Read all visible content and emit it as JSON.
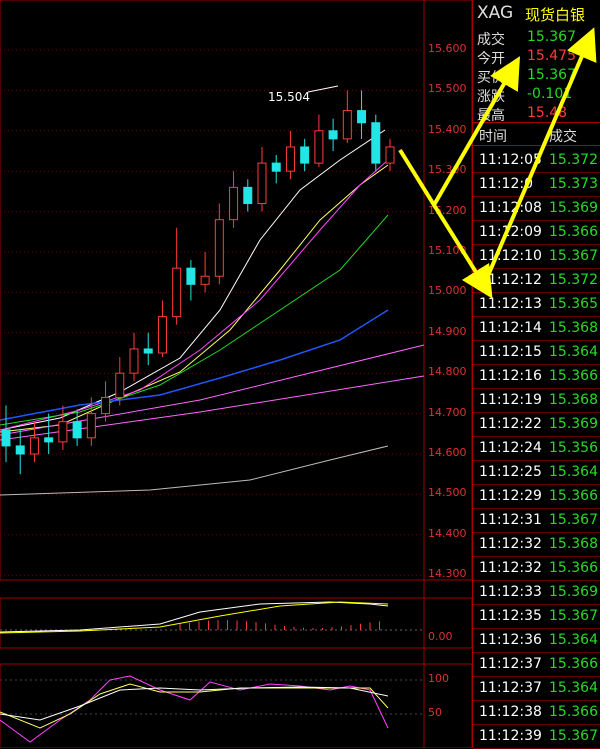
{
  "instrument": {
    "code": "XAG",
    "name": "现货白银"
  },
  "quote": [
    {
      "label": "成交",
      "value": "15.367",
      "color": "#22dd22"
    },
    {
      "label": "今开",
      "value": "15.475",
      "color": "#ff3b3b"
    },
    {
      "label": "买价",
      "value": "15.367",
      "color": "#22dd22"
    },
    {
      "label": "涨跌",
      "value": "-0.101",
      "color": "#22dd22"
    },
    {
      "label": "最高",
      "value": "15.48",
      "color": "#ff3b3b"
    }
  ],
  "ticks_header": {
    "time": "时间",
    "deal": "成交"
  },
  "ticks": [
    {
      "time": "11:12:05",
      "price": "15.372"
    },
    {
      "time": "11:12:0",
      "price": "15.373"
    },
    {
      "time": "11:12:08",
      "price": "15.369"
    },
    {
      "time": "11:12:09",
      "price": "15.366"
    },
    {
      "time": "11:12:10",
      "price": "15.367"
    },
    {
      "time": "11:12:12",
      "price": "15.372"
    },
    {
      "time": "11:12:13",
      "price": "15.365"
    },
    {
      "time": "11:12:14",
      "price": "15.368"
    },
    {
      "time": "11:12:15",
      "price": "15.364"
    },
    {
      "time": "11:12:16",
      "price": "15.366"
    },
    {
      "time": "11:12:19",
      "price": "15.368"
    },
    {
      "time": "11:12:22",
      "price": "15.369"
    },
    {
      "time": "11:12:24",
      "price": "15.356"
    },
    {
      "time": "11:12:25",
      "price": "15.364"
    },
    {
      "time": "11:12:29",
      "price": "15.366"
    },
    {
      "time": "11:12:31",
      "price": "15.367"
    },
    {
      "time": "11:12:32",
      "price": "15.368"
    },
    {
      "time": "11:12:32",
      "price": "15.366"
    },
    {
      "time": "11:12:33",
      "price": "15.369"
    },
    {
      "time": "11:12:35",
      "price": "15.367"
    },
    {
      "time": "11:12:36",
      "price": "15.364"
    },
    {
      "time": "11:12:37",
      "price": "15.366"
    },
    {
      "time": "11:12:37",
      "price": "15.364"
    },
    {
      "time": "11:12:38",
      "price": "15.366"
    },
    {
      "time": "11:12:39",
      "price": "15.367"
    }
  ],
  "price_axis": [
    "15.600",
    "15.500",
    "15.400",
    "15.300",
    "15.200",
    "15.100",
    "15.000",
    "14.900",
    "14.800",
    "14.700",
    "14.600",
    "14.500",
    "14.400",
    "14.300"
  ],
  "high_marker": "15.504",
  "macd_axis": "0.00",
  "kdj_axis": [
    "100",
    "50"
  ],
  "colors": {
    "up": "#ff3b3b",
    "down": "#22e5e5",
    "grid": "#a00000",
    "annotation_arrow": "#ffff00"
  },
  "chart_data": {
    "type": "candlestick",
    "ylim": [
      14.25,
      15.62
    ],
    "candles": [
      [
        14.66,
        14.62,
        14.72,
        14.58
      ],
      [
        14.62,
        14.6,
        14.66,
        14.55
      ],
      [
        14.6,
        14.64,
        14.68,
        14.58
      ],
      [
        14.64,
        14.63,
        14.7,
        14.6
      ],
      [
        14.63,
        14.68,
        14.72,
        14.61
      ],
      [
        14.68,
        14.64,
        14.71,
        14.62
      ],
      [
        14.64,
        14.7,
        14.74,
        14.62
      ],
      [
        14.7,
        14.74,
        14.78,
        14.68
      ],
      [
        14.74,
        14.8,
        14.84,
        14.72
      ],
      [
        14.8,
        14.86,
        14.9,
        14.78
      ],
      [
        14.86,
        14.85,
        14.9,
        14.82
      ],
      [
        14.85,
        14.94,
        14.98,
        14.84
      ],
      [
        14.94,
        15.06,
        15.16,
        14.92
      ],
      [
        15.06,
        15.02,
        15.08,
        14.98
      ],
      [
        15.02,
        15.04,
        15.1,
        15.0
      ],
      [
        15.04,
        15.18,
        15.22,
        15.02
      ],
      [
        15.18,
        15.26,
        15.3,
        15.16
      ],
      [
        15.26,
        15.22,
        15.28,
        15.2
      ],
      [
        15.22,
        15.32,
        15.36,
        15.2
      ],
      [
        15.32,
        15.3,
        15.34,
        15.27
      ],
      [
        15.3,
        15.36,
        15.4,
        15.28
      ],
      [
        15.36,
        15.32,
        15.38,
        15.3
      ],
      [
        15.32,
        15.4,
        15.44,
        15.31
      ],
      [
        15.4,
        15.38,
        15.43,
        15.35
      ],
      [
        15.38,
        15.45,
        15.5,
        15.37
      ],
      [
        15.45,
        15.42,
        15.5,
        15.38
      ],
      [
        15.42,
        15.32,
        15.44,
        15.3
      ],
      [
        15.32,
        15.36,
        15.38,
        15.3
      ]
    ]
  }
}
